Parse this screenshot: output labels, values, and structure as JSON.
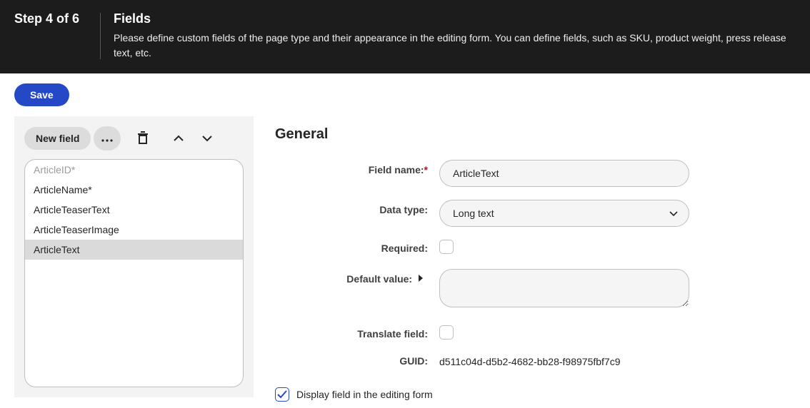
{
  "header": {
    "step_label": "Step 4 of 6",
    "title": "Fields",
    "description": "Please define custom fields of the page type and their appearance in the editing form. You can define fields, such as SKU, product weight, press release text, etc."
  },
  "toolbar": {
    "save_label": "Save"
  },
  "sidebar": {
    "new_field_label": "New field",
    "fields": [
      {
        "name": "ArticleID*",
        "disabled": true,
        "selected": false
      },
      {
        "name": "ArticleName*",
        "disabled": false,
        "selected": false
      },
      {
        "name": "ArticleTeaserText",
        "disabled": false,
        "selected": false
      },
      {
        "name": "ArticleTeaserImage",
        "disabled": false,
        "selected": false
      },
      {
        "name": "ArticleText",
        "disabled": false,
        "selected": true
      }
    ]
  },
  "form": {
    "section_title": "General",
    "labels": {
      "field_name": "Field name:",
      "data_type": "Data type:",
      "required": "Required:",
      "default_value": "Default value:",
      "translate_field": "Translate field:",
      "guid": "GUID:",
      "display_in_form": "Display field in the editing form"
    },
    "values": {
      "field_name": "ArticleText",
      "data_type": "Long text",
      "required_checked": false,
      "default_value": "",
      "translate_checked": false,
      "guid": "d511c04d-d5b2-4682-bb28-f98975fbf7c9",
      "display_in_form_checked": true
    }
  }
}
